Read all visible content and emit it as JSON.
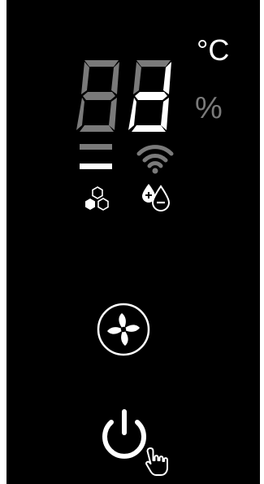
{
  "display": {
    "temperature_unit": "°C",
    "humidity_unit": "%",
    "digits": [
      {
        "value": "8",
        "state": "dim"
      },
      {
        "value": "8",
        "state": "partial"
      }
    ],
    "bars": [
      {
        "state": "dim"
      },
      {
        "state": "on"
      }
    ],
    "wifi_state": "dim"
  },
  "icons": {
    "filter": "honeycomb-filter-icon",
    "humidity_adjust": "droplet-plus-minus-icon",
    "fan": "fan-icon",
    "power": "power-icon",
    "cursor": "hand-pointer-icon"
  },
  "colors": {
    "background": "#000000",
    "on": "#ffffff",
    "dim": "#7a7a7a"
  }
}
